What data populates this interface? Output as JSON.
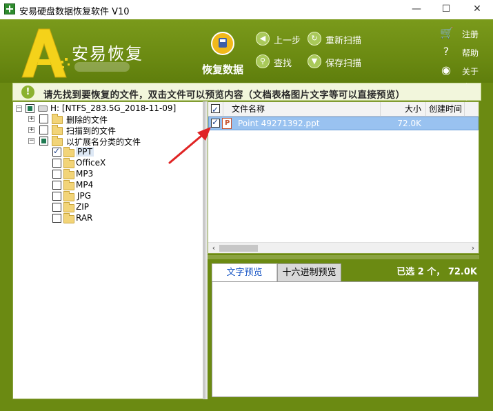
{
  "window": {
    "title": "安易硬盘数据恢复软件 V10",
    "minimize": "—",
    "maximize": "☐",
    "close": "✕"
  },
  "header": {
    "logo_letter": "A",
    "logo_text": "安易恢复",
    "recover_label": "恢复数据",
    "tools": {
      "back": "上一步",
      "rescan": "重新扫描",
      "find": "查找",
      "save_scan": "保存扫描"
    },
    "side": {
      "register": "注册",
      "help": "帮助",
      "about": "关于"
    }
  },
  "banner": {
    "text": "请先找到要恢复的文件，双击文件可以预览内容（文档表格图片文字等可以直接预览）"
  },
  "tree": {
    "root": "H: [NTFS_283.5G_2018-11-09]",
    "deleted": "删除的文件",
    "scanned": "扫描到的文件",
    "by_ext": "以扩展名分类的文件",
    "ext": [
      "PPT",
      "OfficeX",
      "MP3",
      "MP4",
      "JPG",
      "ZIP",
      "RAR"
    ]
  },
  "filelist": {
    "columns": {
      "name": "文件名称",
      "size": "大小",
      "created": "创建时间"
    },
    "rows": [
      {
        "name": "Point 49271392.ppt",
        "size": "72.0K",
        "created": ""
      }
    ]
  },
  "preview": {
    "tab_text": "文字预览",
    "tab_hex": "十六进制预览",
    "selected_info": "已选 2 个， 72.0K"
  },
  "colors": {
    "frame_green": "#6b8a12",
    "row_select": "#99c2f0",
    "annotation": "#e02424"
  }
}
